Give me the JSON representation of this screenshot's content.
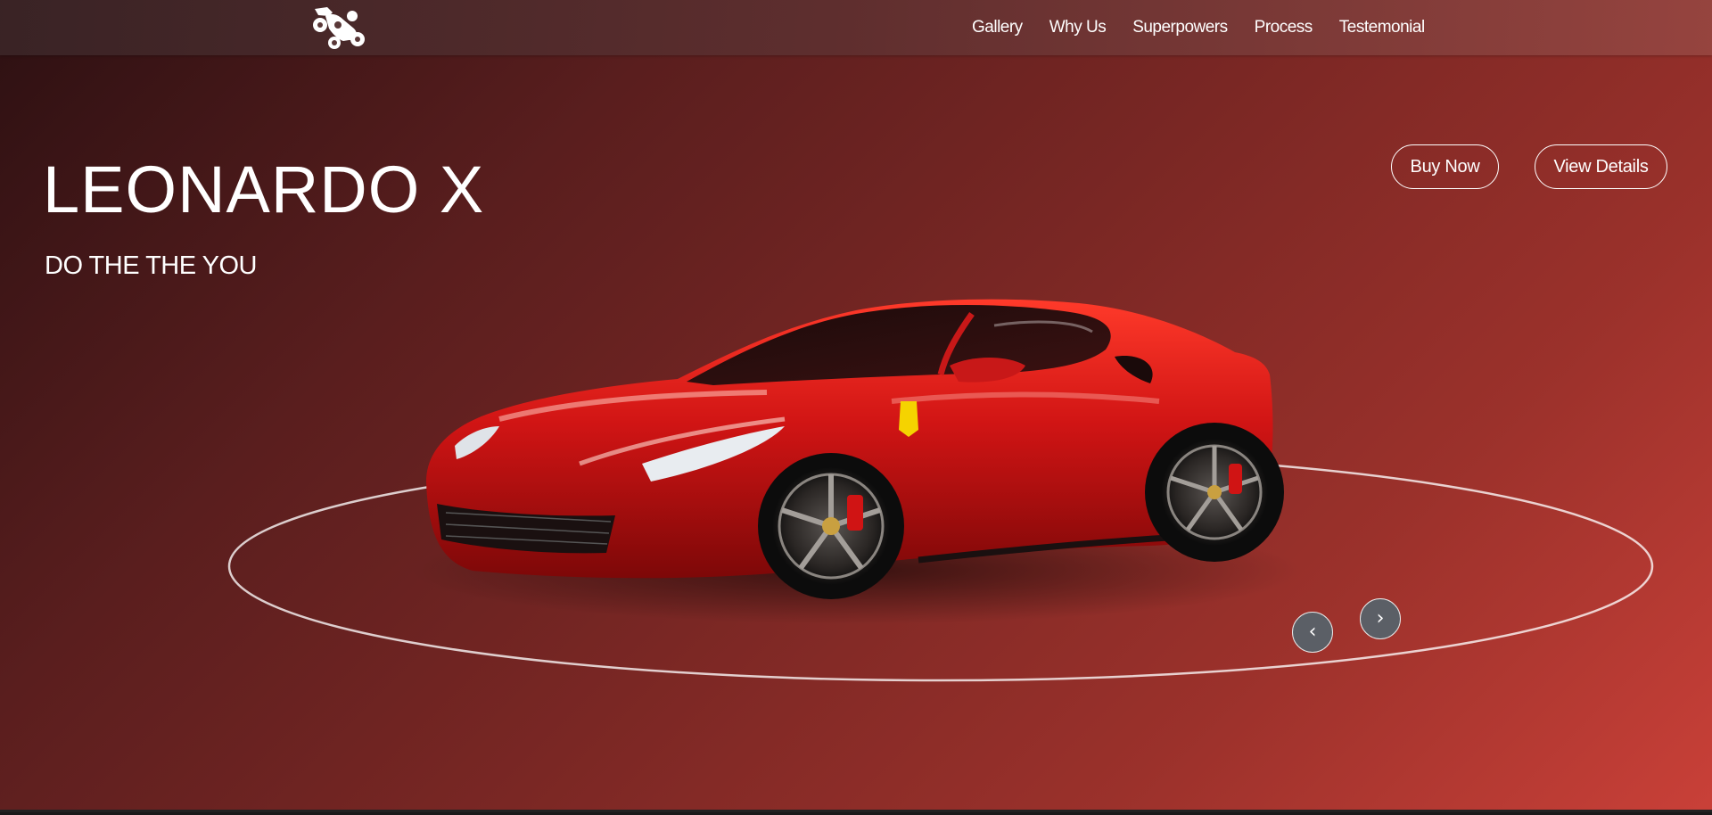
{
  "nav": {
    "logo_icon": "race-car-icon",
    "links": [
      "Gallery",
      "Why Us",
      "Superpowers",
      "Process",
      "Testemonial"
    ]
  },
  "hero": {
    "title": "LEONARDO X",
    "subtitle": "DO THE THE YOU"
  },
  "actions": {
    "buy_label": "Buy Now",
    "details_label": "View Details"
  },
  "carousel": {
    "prev_icon": "chevron-left-icon",
    "next_icon": "chevron-right-icon",
    "prev_glyph": "‹",
    "next_glyph": "›",
    "image": "red-sports-car"
  },
  "colors": {
    "accent": "#c94038",
    "background_dark": "#2c1012",
    "car_red": "#d01414"
  }
}
